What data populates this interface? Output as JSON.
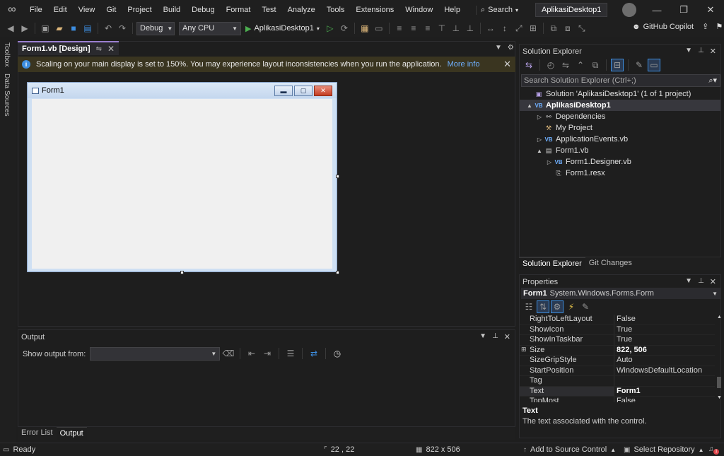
{
  "menubar": {
    "logo": "visual-studio-logo",
    "items": [
      "File",
      "Edit",
      "View",
      "Git",
      "Project",
      "Build",
      "Debug",
      "Format",
      "Test",
      "Analyze",
      "Tools",
      "Extensions",
      "Window",
      "Help"
    ],
    "search_label": "Search",
    "project_title": "AplikasiDesktop1"
  },
  "toolbar": {
    "config": "Debug",
    "platform": "Any CPU",
    "run_target": "AplikasiDesktop1",
    "copilot_label": "GitHub Copilot"
  },
  "left_strip": {
    "tabs": [
      "Toolbox",
      "Data Sources"
    ]
  },
  "document": {
    "tab_title": "Form1.vb [Design]",
    "info_message": "Scaling on your main display is set to 150%. You may experience layout inconsistencies when you run the application.",
    "info_link": "More info",
    "form_title": "Form1"
  },
  "output": {
    "title": "Output",
    "show_from_label": "Show output from:",
    "show_from_value": ""
  },
  "bottom_tabs": [
    "Error List",
    "Output"
  ],
  "solution_explorer": {
    "title": "Solution Explorer",
    "search_placeholder": "Search Solution Explorer (Ctrl+;)",
    "tree": [
      {
        "label": "Solution 'AplikasiDesktop1' (1 of 1 project)",
        "icon": "solution-icon",
        "indent": 0,
        "expander": ""
      },
      {
        "label": "AplikasiDesktop1",
        "icon": "vb-project-icon",
        "indent": 0,
        "expander": "▲",
        "selected": true
      },
      {
        "label": "Dependencies",
        "icon": "dependencies-icon",
        "indent": 1,
        "expander": "▷"
      },
      {
        "label": "My Project",
        "icon": "my-project-icon",
        "indent": 1,
        "expander": ""
      },
      {
        "label": "ApplicationEvents.vb",
        "icon": "vb-file-icon",
        "indent": 1,
        "expander": "▷"
      },
      {
        "label": "Form1.vb",
        "icon": "form-file-icon",
        "indent": 1,
        "expander": "▲"
      },
      {
        "label": "Form1.Designer.vb",
        "icon": "vb-file-icon",
        "indent": 2,
        "expander": "▷"
      },
      {
        "label": "Form1.resx",
        "icon": "resx-file-icon",
        "indent": 2,
        "expander": ""
      }
    ],
    "tabs": [
      "Solution Explorer",
      "Git Changes"
    ]
  },
  "properties": {
    "title": "Properties",
    "object_name": "Form1",
    "object_type": "System.Windows.Forms.Form",
    "rows": [
      {
        "name": "RightToLeftLayout",
        "value": "False"
      },
      {
        "name": "ShowIcon",
        "value": "True"
      },
      {
        "name": "ShowInTaskbar",
        "value": "True"
      },
      {
        "name": "Size",
        "value": "822, 506",
        "bold": true,
        "expandable": true
      },
      {
        "name": "SizeGripStyle",
        "value": "Auto"
      },
      {
        "name": "StartPosition",
        "value": "WindowsDefaultLocation"
      },
      {
        "name": "Tag",
        "value": ""
      },
      {
        "name": "Text",
        "value": "Form1",
        "bold": true,
        "selected": true
      },
      {
        "name": "TopMost",
        "value": "False"
      }
    ],
    "description_title": "Text",
    "description_text": "The text associated with the control."
  },
  "statusbar": {
    "ready": "Ready",
    "position": "22 , 22",
    "size": "822 x 506",
    "source_control": "Add to Source Control",
    "repository": "Select Repository",
    "notification_count": "1"
  }
}
